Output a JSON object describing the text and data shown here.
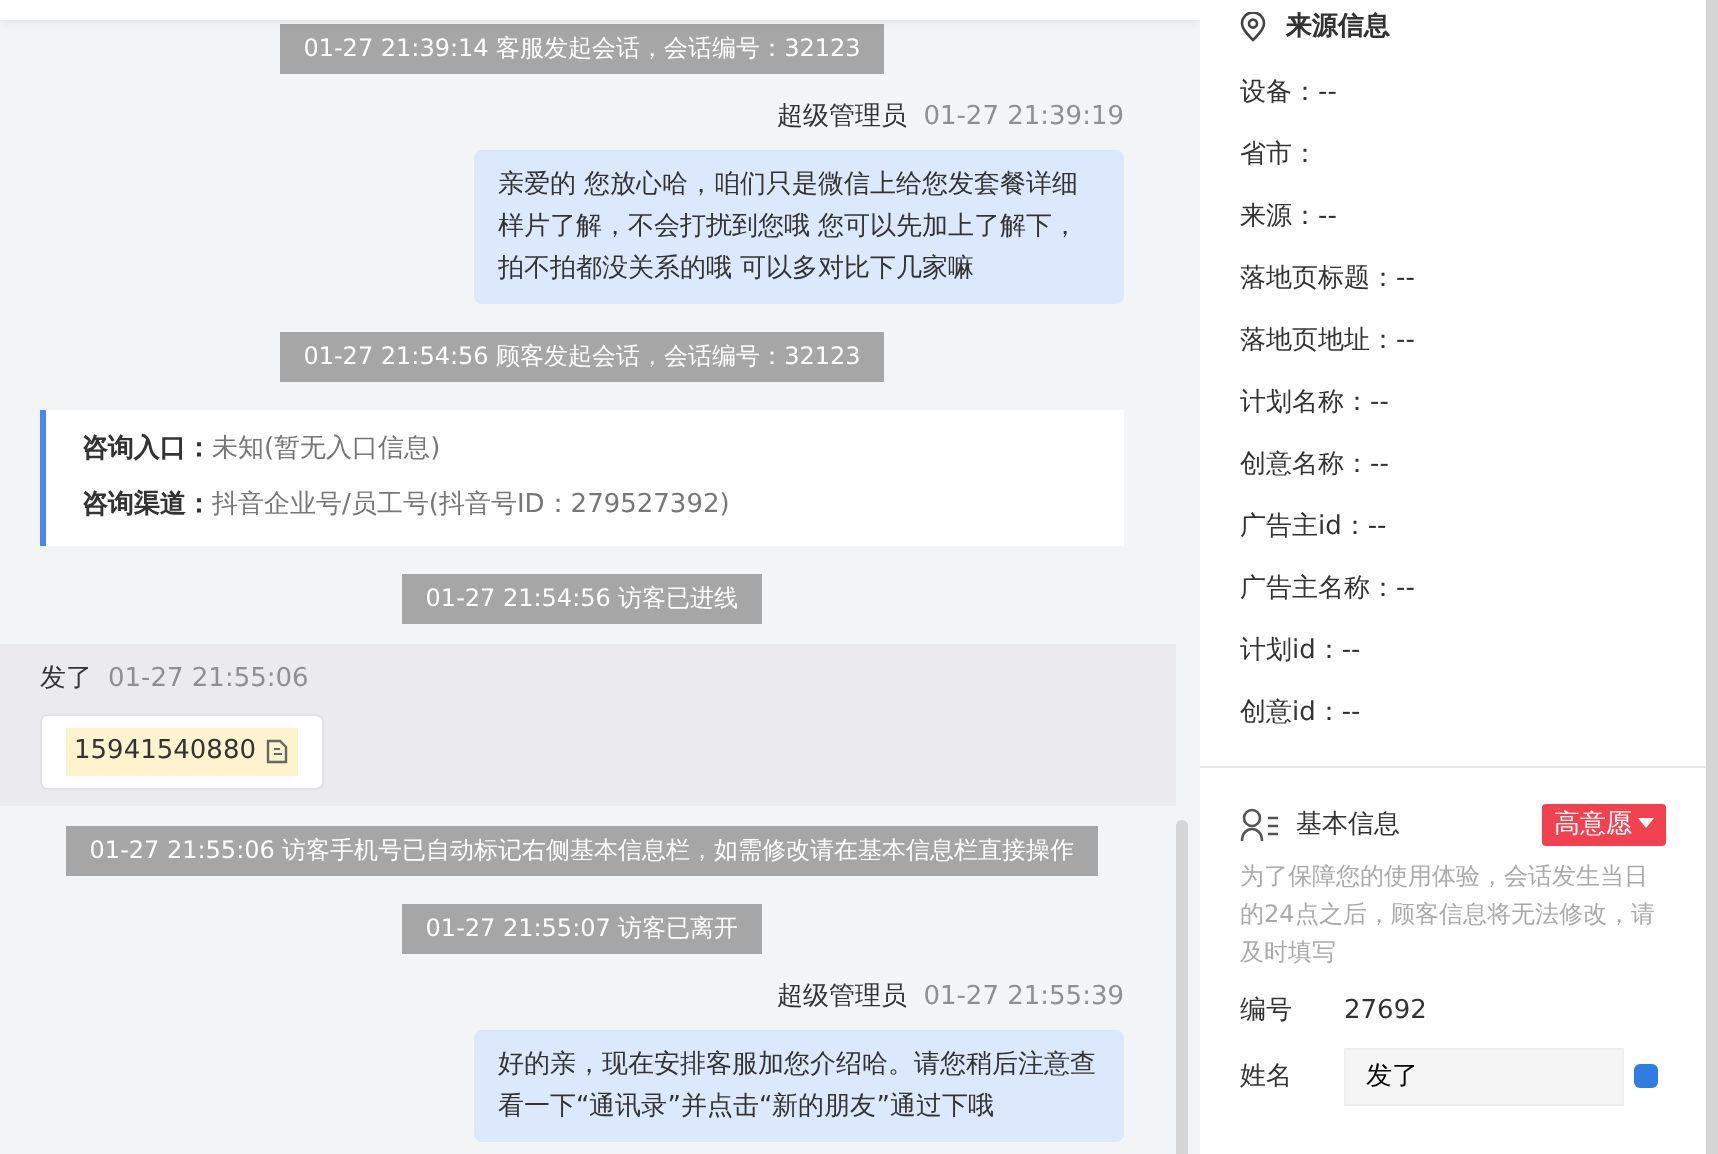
{
  "chat": {
    "messages": [
      {
        "kind": "system",
        "text": "01-27 21:39:14 客服发起会话，会话编号：32123"
      },
      {
        "kind": "agent",
        "sender": "超级管理员",
        "time": "01-27 21:39:19",
        "text": "亲爱的 您放心哈，咱们只是微信上给您发套餐详细样片了解，不会打扰到您哦 您可以先加上了解下，拍不拍都没关系的哦 可以多对比下几家嘛"
      },
      {
        "kind": "system",
        "text": "01-27 21:54:56 顾客发起会话，会话编号：32123"
      },
      {
        "kind": "info",
        "rows": [
          {
            "label": "咨询入口：",
            "value": "未知(暂无入口信息)"
          },
          {
            "label": "咨询渠道：",
            "value": "抖音企业号/员工号(抖音号ID：279527392)"
          }
        ]
      },
      {
        "kind": "system",
        "text": "01-27 21:54:56 访客已进线"
      },
      {
        "kind": "visitor",
        "sender": "发了",
        "time": "01-27 21:55:06",
        "phone": "15941540880"
      },
      {
        "kind": "system",
        "text": "01-27 21:55:06 访客手机号已自动标记右侧基本信息栏，如需修改请在基本信息栏直接操作"
      },
      {
        "kind": "system",
        "text": "01-27 21:55:07 访客已离开"
      },
      {
        "kind": "agent",
        "sender": "超级管理员",
        "time": "01-27 21:55:39",
        "text": "好的亲，现在安排客服加您介绍哈。请您稍后注意查看一下“通讯录”并点击“新的朋友”通过下哦"
      }
    ]
  },
  "source_info": {
    "title": "来源信息",
    "rows": [
      "设备：--",
      "省市：",
      "来源：--",
      "落地页标题：--",
      "落地页地址：--",
      "计划名称：--",
      "创意名称：--",
      "广告主id：--",
      "广告主名称：--",
      "计划id：--",
      "创意id：--"
    ]
  },
  "basic_info": {
    "title": "基本信息",
    "intent": "高意愿",
    "note": "为了保障您的使用体验，会话发生当日的24点之后，顾客信息将无法修改，请及时填写",
    "fields": [
      {
        "kind": "text",
        "label": "编号",
        "value": "27692"
      },
      {
        "kind": "input",
        "label": "姓名",
        "value": "发了"
      }
    ]
  }
}
